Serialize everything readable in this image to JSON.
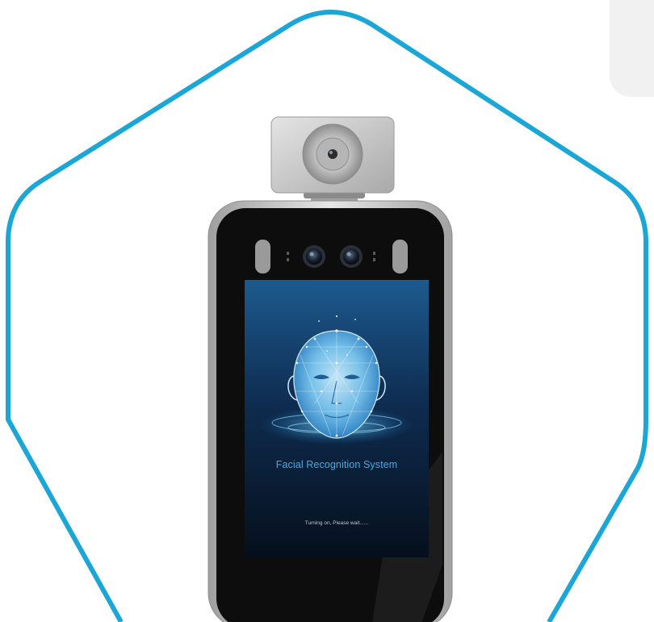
{
  "device": {
    "screen_title": "Facial Recognition System",
    "screen_status": "Turning on, Please wait......"
  },
  "colors": {
    "hexagon_outline": "#1aa7d8",
    "bezel": "#0d0d0d",
    "frame": "#c4c4c4",
    "screen_blue": "#1f5c92",
    "title_text": "#4ea8e0"
  },
  "icons": {
    "thermal_sensor": "thermal-sensor-icon",
    "camera": "camera-lens-icon",
    "face_scan": "face-scan-icon"
  }
}
